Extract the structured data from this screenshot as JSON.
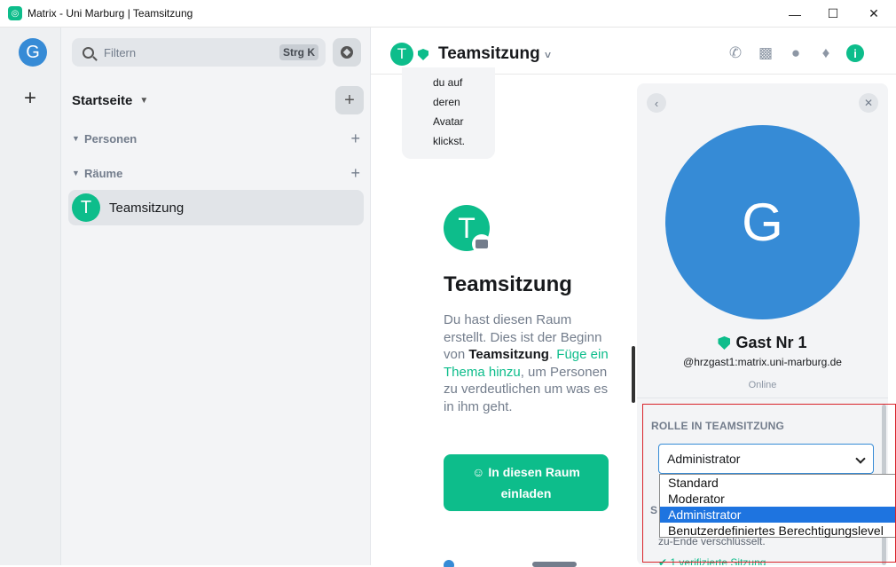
{
  "window": {
    "title": "Matrix - Uni Marburg | Teamsitzung",
    "minimize": "—",
    "maximize": "☐",
    "close": "✕"
  },
  "rail": {
    "avatar_letter": "G",
    "add_label": "+"
  },
  "sidebar": {
    "search_placeholder": "Filtern",
    "search_shortcut": "Strg K",
    "home_label": "Startseite",
    "home_add": "+",
    "sections": [
      {
        "label": "Personen",
        "add": "+"
      },
      {
        "label": "Räume",
        "add": "+"
      }
    ],
    "rooms": [
      {
        "letter": "T",
        "name": "Teamsitzung"
      }
    ]
  },
  "room_header": {
    "avatar_letter": "T",
    "title": "Teamsitzung",
    "title_chevron": "˅",
    "icons": [
      "phone-icon",
      "video-icon",
      "threads-icon",
      "bell-icon",
      "info-icon"
    ],
    "info_label": "i"
  },
  "timeline": {
    "tooltip_lines": [
      "du auf",
      "deren",
      "Avatar",
      "klickst."
    ],
    "room_avatar_letter": "T",
    "room_title": "Teamsitzung",
    "intro_pre": "Du hast diesen Raum erstellt. Dies ist der Beginn von ",
    "intro_bold": "Teamsitzung",
    "intro_mid": ". ",
    "intro_link": "Füge ein Thema hinzu",
    "intro_post": ", um Personen zu verdeutlichen um was es in ihm geht.",
    "invite_line1": "In diesen Raum",
    "invite_line2": "einladen"
  },
  "user_panel": {
    "back": "‹",
    "close": "✕",
    "avatar_letter": "G",
    "display_name": "Gast Nr 1",
    "mxid": "@hrzgast1:matrix.uni-marburg.de",
    "presence": "Online",
    "role_heading": "ROLLE IN TEAMSITZUNG",
    "role_selected": "Administrator",
    "role_options": [
      "Standard",
      "Moderator",
      "Administrator",
      "Benutzerdefiniertes Berechtigungslevel"
    ],
    "role_selected_index": 2,
    "behind_heading_fragment": "S",
    "behind_text": "zu-Ende verschlüsselt.",
    "behind_verified": "1 verifizierte Sitzung"
  },
  "colors": {
    "accent": "#0dbd8b",
    "avatar_blue": "#368bd6",
    "highlight_red": "#d9232a",
    "selected_option": "#1e74e0"
  }
}
